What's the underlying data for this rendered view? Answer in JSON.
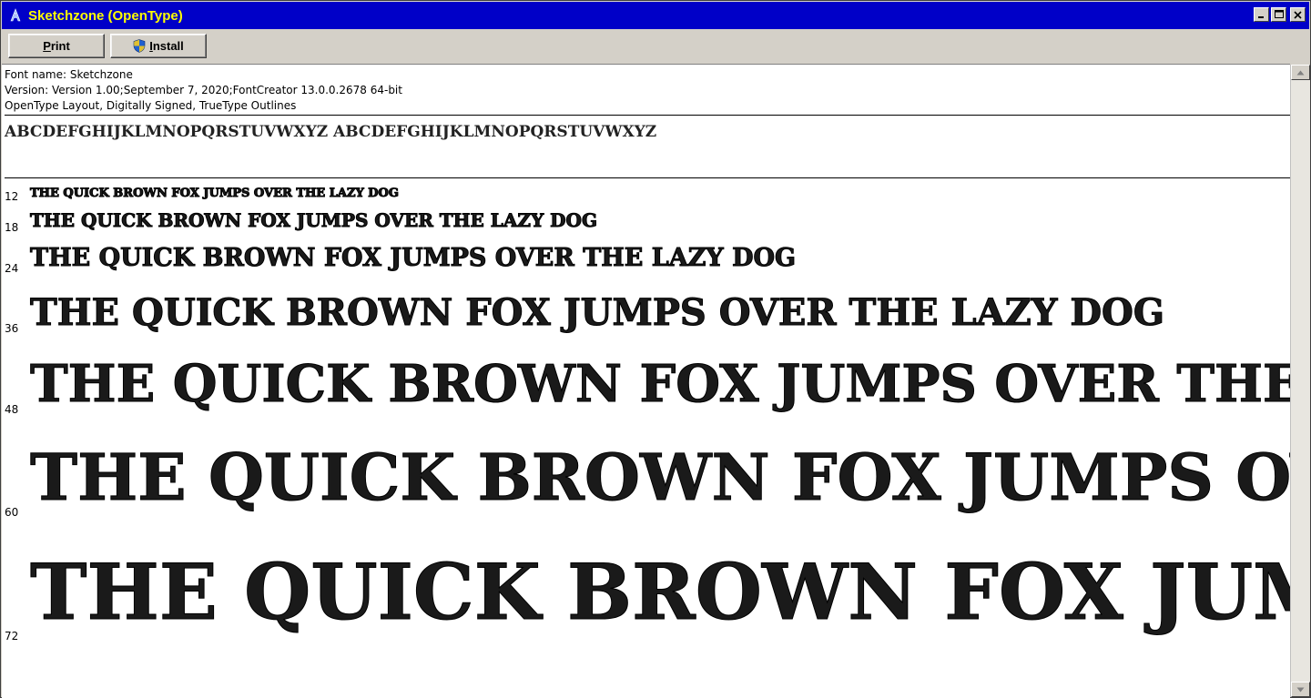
{
  "window": {
    "title": "Sketchzone (OpenType)",
    "icon": "font-viewer-app-icon",
    "controls": [
      "minimize",
      "maximize",
      "close"
    ]
  },
  "toolbar": {
    "print_label_accel": "P",
    "print_label_rest": "rint",
    "install_label_accel": "I",
    "install_label_rest": "nstall",
    "install_icon": "uac-shield-icon"
  },
  "info": {
    "font_name": "Font name: Sketchzone",
    "version": "Version: Version 1.00;September 7, 2020;FontCreator 13.0.0.2678 64-bit",
    "features": "OpenType Layout, Digitally Signed, TrueType Outlines"
  },
  "alphabet": "ABCDEFGHIJKLMNOPQRSTUVWXYZ ABCDEFGHIJKLMNOPQRSTUVWXYZ",
  "samples": [
    {
      "size": "12",
      "text": "THE QUICK BROWN FOX JUMPS OVER THE LAZY DOG"
    },
    {
      "size": "18",
      "text": "THE QUICK BROWN FOX JUMPS OVER THE LAZY DOG"
    },
    {
      "size": "24",
      "text": "THE QUICK BROWN FOX JUMPS OVER THE LAZY DOG"
    },
    {
      "size": "36",
      "text": "THE QUICK BROWN FOX JUMPS OVER THE LAZY DOG"
    },
    {
      "size": "48",
      "text": "THE QUICK BROWN FOX JUMPS OVER THE LAZY DOG"
    },
    {
      "size": "60",
      "text": "THE QUICK BROWN FOX JUMPS OVER THE"
    },
    {
      "size": "72",
      "text": "THE QUICK BROWN FOX JUMPS OVE"
    }
  ],
  "colors": {
    "titlebar": "#0000c8",
    "title_text": "#ffff00",
    "chrome": "#d4d0c8"
  }
}
